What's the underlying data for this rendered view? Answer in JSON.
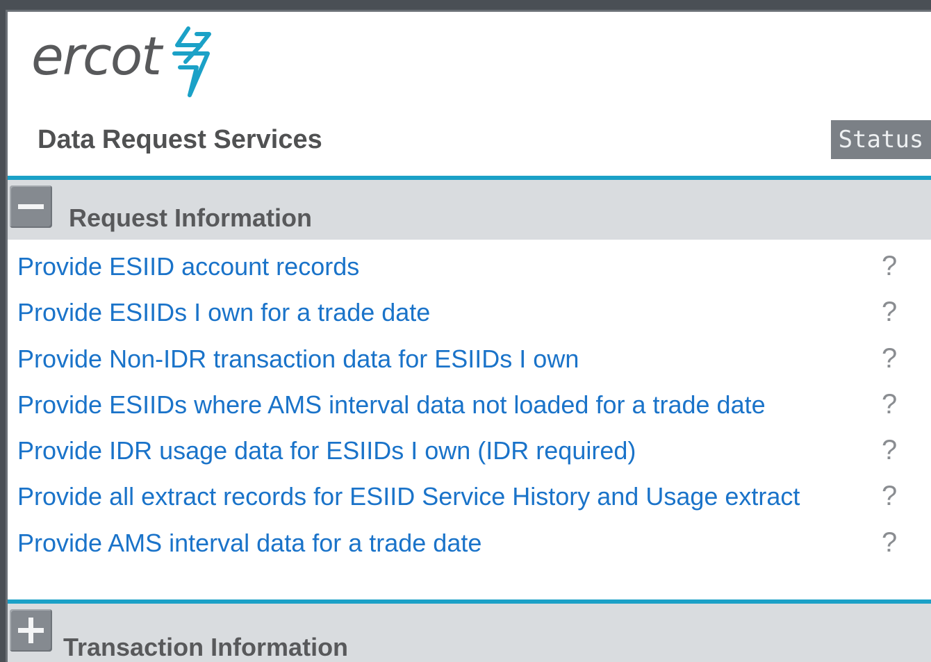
{
  "header": {
    "logo_text": "ercot",
    "app_title": "Data Request Services",
    "status_label": "Status",
    "brand_color": "#1ba1c7"
  },
  "sections": [
    {
      "title": "Request Information",
      "expanded": true,
      "toggle_icon": "minus-icon",
      "items": [
        {
          "label": "Provide ESIID account records",
          "help": "?"
        },
        {
          "label": "Provide ESIIDs I own for a trade date",
          "help": "?"
        },
        {
          "label": "Provide Non-IDR transaction data for ESIIDs I own",
          "help": "?"
        },
        {
          "label": "Provide ESIIDs where AMS interval data not loaded for a trade date",
          "help": "?"
        },
        {
          "label": "Provide IDR usage data for ESIIDs I own (IDR required)",
          "help": "?"
        },
        {
          "label": "Provide all extract records for ESIID Service History and Usage extract",
          "help": "?"
        },
        {
          "label": "Provide AMS interval data for a trade date",
          "help": "?"
        }
      ]
    },
    {
      "title": "Transaction Information",
      "expanded": false,
      "toggle_icon": "plus-icon"
    }
  ]
}
